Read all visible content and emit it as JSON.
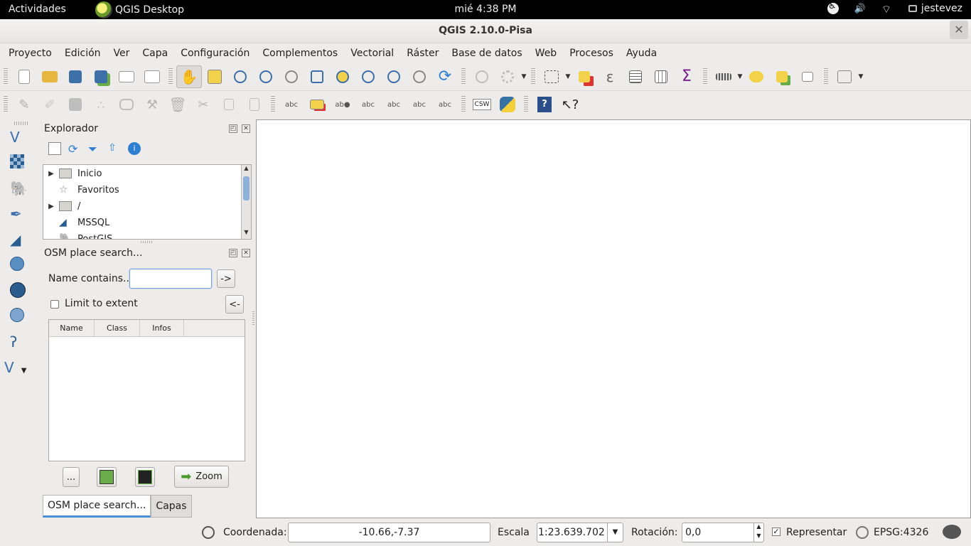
{
  "topbar": {
    "activities": "Actividades",
    "app_name": "QGIS Desktop",
    "clock": "mié 4:38 PM",
    "user": "jestevez",
    "icons": [
      "accessibility-icon",
      "volume-icon",
      "wifi-icon"
    ]
  },
  "window": {
    "title": "QGIS 2.10.0-Pisa",
    "close_glyph": "✕"
  },
  "menubar": [
    "Proyecto",
    "Edición",
    "Ver",
    "Capa",
    "Configuración",
    "Complementos",
    "Vectorial",
    "Ráster",
    "Base de datos",
    "Web",
    "Procesos",
    "Ayuda"
  ],
  "toolbar1": {
    "icons": [
      "new-project-icon",
      "open-project-icon",
      "save-project-icon",
      "save-as-icon",
      "new-print-composer-icon",
      "composer-manager-icon",
      "pan-icon",
      "pan-to-selection-icon",
      "zoom-in-icon",
      "zoom-out-icon",
      "zoom-actual-size-icon",
      "zoom-full-icon",
      "zoom-to-selection-icon",
      "zoom-to-layer-icon",
      "zoom-last-icon",
      "zoom-next-icon",
      "refresh-icon",
      "identify-icon",
      "run-action-icon",
      "select-features-icon",
      "deselect-icon",
      "expression-select-icon",
      "attribute-table-icon",
      "field-calculator-icon",
      "statistics-icon",
      "measure-icon",
      "map-tips-icon",
      "new-bookmark-icon",
      "show-bookmarks-icon",
      "text-annotation-icon"
    ]
  },
  "toolbar2": {
    "icons": [
      "digitize-icon",
      "toggle-editing-icon",
      "save-edits-icon",
      "add-feature-icon",
      "move-feature-icon",
      "node-tool-icon",
      "delete-selected-icon",
      "cut-features-icon",
      "copy-features-icon",
      "paste-features-icon",
      "label-icon",
      "highlight-label-icon",
      "pin-label-icon",
      "show-hide-label-icon",
      "move-label-icon",
      "rotate-label-icon",
      "change-label-icon",
      "csw-icon",
      "python-console-icon",
      "help-contents-icon",
      "whats-this-icon"
    ],
    "csw_label": "CSW",
    "help_glyph": "?",
    "whats_this_glyph": "?"
  },
  "left_toolbar": {
    "icons": [
      "add-vector-layer-icon",
      "add-raster-layer-icon",
      "add-postgis-layer-icon",
      "add-spatialite-layer-icon",
      "add-mssql-layer-icon",
      "add-wms-layer-icon",
      "add-wcs-layer-icon",
      "add-wfs-layer-icon",
      "add-delimited-text-icon",
      "new-shapefile-layer-icon"
    ]
  },
  "explorer": {
    "title": "Explorador",
    "tree": [
      {
        "label": "Inicio",
        "icon": "folder-icon",
        "expandable": true
      },
      {
        "label": "Favoritos",
        "icon": "star-icon",
        "expandable": false
      },
      {
        "label": "/",
        "icon": "folder-icon",
        "expandable": true
      },
      {
        "label": "MSSQL",
        "icon": "mssql-icon",
        "expandable": false
      },
      {
        "label": "PostGIS",
        "icon": "postgis-icon",
        "expandable": false
      }
    ]
  },
  "osm": {
    "title": "OSM place search...",
    "name_label": "Name contains...",
    "name_value": "",
    "go_button": "->",
    "limit_label": "Limit to extent",
    "limit_checked": false,
    "back_button": "<-",
    "columns": [
      "Name",
      "Class",
      "Infos"
    ],
    "more_button": "...",
    "zoom_button": "Zoom"
  },
  "dock_tabs": [
    "OSM place search...",
    "Capas"
  ],
  "statusbar": {
    "coord_label": "Coordenada:",
    "coord_value": "-10.66,-7.37",
    "scale_label": "Escala",
    "scale_value": "1:23.639.702",
    "rotation_label": "Rotación:",
    "rotation_value": "0,0",
    "render_label": "Representar",
    "render_checked": true,
    "crs": "EPSG:4326"
  },
  "colors": {
    "accent": "#4a90d9",
    "topbar": "#000000",
    "map_bg": "#ffffff"
  }
}
